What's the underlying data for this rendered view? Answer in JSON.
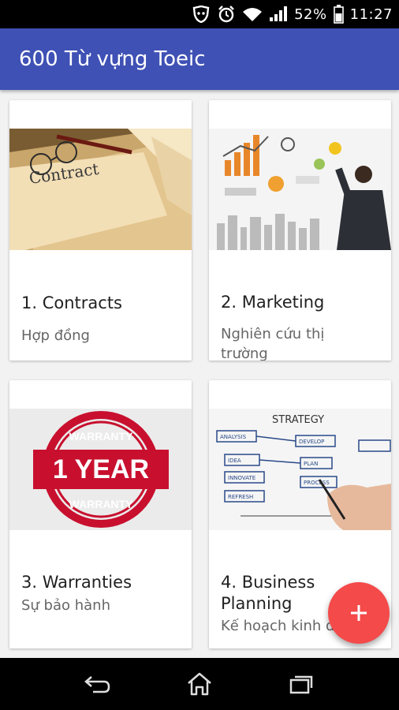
{
  "status_bar": {
    "battery_percent": "52%",
    "time": "11:27",
    "icons": [
      "shield-notification-icon",
      "alarm-icon",
      "wifi-icon",
      "signal-icon",
      "battery-icon"
    ]
  },
  "app_bar": {
    "title": "600 Từ vựng Toeic",
    "color": "#3f51b5"
  },
  "cards": [
    {
      "title": "1. Contracts",
      "subtitle": "Hợp đồng",
      "image": "contract-document-image"
    },
    {
      "title": "2. Marketing",
      "subtitle": "Nghiên cứu thị trường",
      "image": "marketing-whiteboard-image"
    },
    {
      "title": "3. Warranties",
      "subtitle": "Sự bảo hành",
      "image": "warranty-stamp-image",
      "stamp_text": {
        "top": "WARRANTY",
        "middle": "1 YEAR",
        "bottom": "WARRANTY"
      }
    },
    {
      "title": "4. Business Planning",
      "subtitle": "Kế hoạch kinh doanh",
      "image": "strategy-flowchart-image",
      "strategy_text": {
        "header": "STRATEGY",
        "boxes": [
          "ANALYSIS",
          "DEVELOP",
          "IDEA",
          "INNOVATE",
          "REFRESH",
          "PLAN",
          "PROCESS"
        ]
      }
    }
  ],
  "fab": {
    "icon": "add-icon",
    "color": "#f44a4a"
  },
  "nav_bar": {
    "icons": [
      "back-icon",
      "home-icon",
      "recent-apps-icon"
    ]
  }
}
